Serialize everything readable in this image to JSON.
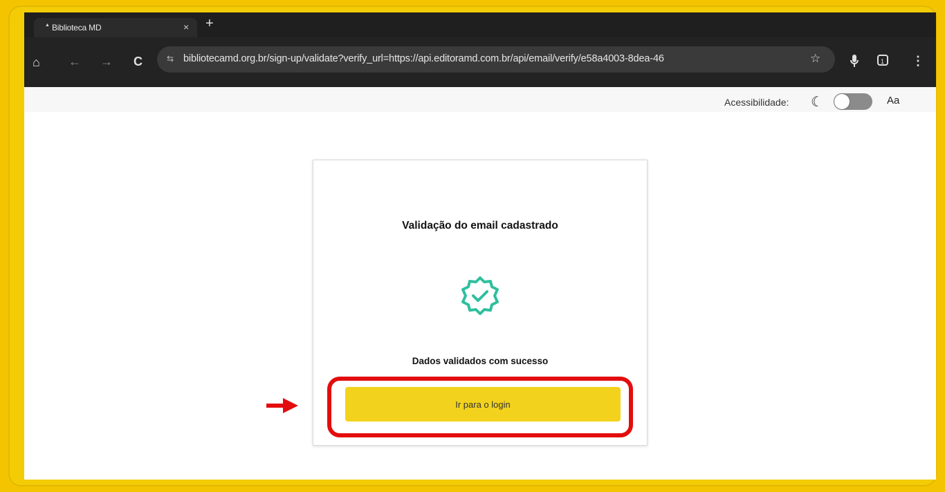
{
  "browser": {
    "tab_title": "Biblioteca MD",
    "tab_close": "×",
    "new_tab": "+",
    "url": "bibliotecamd.org.br/sign-up/validate?verify_url=https://api.editoramd.com.br/api/email/verify/e58a4003-8dea-46",
    "tab_count": "1"
  },
  "accessibility": {
    "label": "Acessibilidade:",
    "dark_mode_on": false,
    "font_size_label": "Aa"
  },
  "card": {
    "title": "Validação do email cadastrado",
    "message": "Dados validados com sucesso",
    "button_label": "Ir para o login"
  },
  "colors": {
    "frame": "#f3cc06",
    "badge": "#2fbf9d",
    "button": "#f3d21d",
    "highlight": "#e30d0d"
  }
}
